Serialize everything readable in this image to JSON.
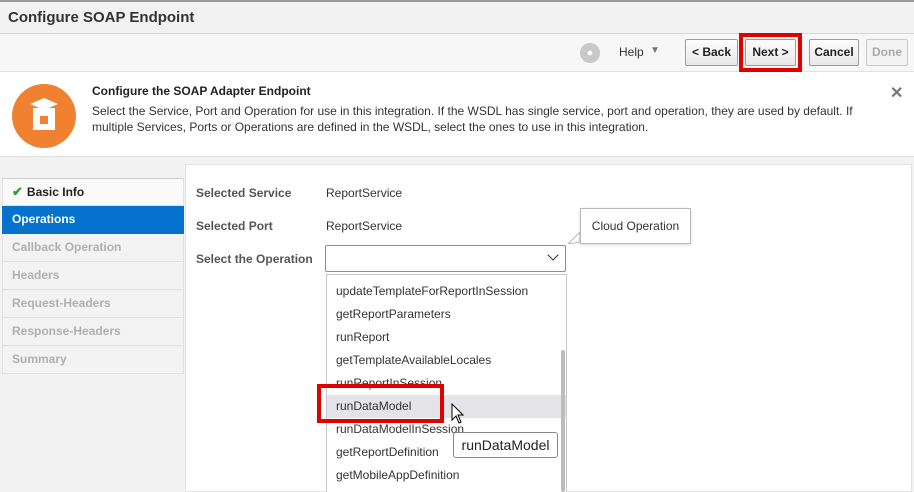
{
  "window": {
    "title": "Configure SOAP Endpoint"
  },
  "toolbar": {
    "help_label": "Help",
    "back_label": "< Back",
    "next_label": "Next >",
    "cancel_label": "Cancel",
    "done_label": "Done"
  },
  "banner": {
    "title": "Configure the SOAP Adapter Endpoint",
    "text": "Select the Service, Port and Operation for use in this integration. If the WSDL has single service, port and operation, they are used by default. If multiple Services, Ports or Operations are defined in the WSDL, select the ones to use in this integration.",
    "accent": "#ef8131"
  },
  "nav": {
    "items": [
      {
        "label": "Basic Info",
        "state": "done"
      },
      {
        "label": "Operations",
        "state": "active"
      },
      {
        "label": "Callback Operation",
        "state": "disabled"
      },
      {
        "label": "Headers",
        "state": "disabled"
      },
      {
        "label": "Request-Headers",
        "state": "disabled"
      },
      {
        "label": "Response-Headers",
        "state": "disabled"
      },
      {
        "label": "Summary",
        "state": "disabled"
      }
    ],
    "active_color": "#0572ce"
  },
  "form": {
    "service_label": "Selected Service",
    "service_value": "ReportService",
    "port_label": "Selected Port",
    "port_value": "ReportService",
    "operation_label": "Select the Operation",
    "operation_value": "",
    "tooltip": "Cloud Operation"
  },
  "dropdown": {
    "options": [
      "updateTemplateForReportInSession",
      "getReportParameters",
      "runReport",
      "getTemplateAvailableLocales",
      "runReportInSession",
      "runDataModel",
      "runDataModelInSession",
      "getReportDefinition",
      "getMobileAppDefinition"
    ],
    "hovered": "runDataModel",
    "hover_tooltip": "runDataModel"
  },
  "highlight_color": "#e00000"
}
